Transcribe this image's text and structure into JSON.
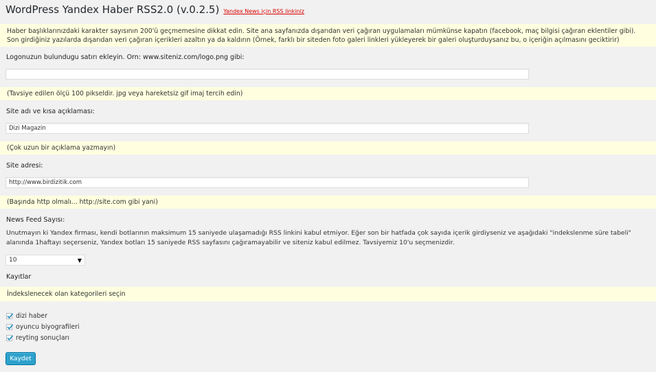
{
  "header": {
    "title": "WordPress Yandex Haber RSS2.0 (v.0.2.5)",
    "link": "Yandex News için RSS linkiniz"
  },
  "top_notice": "Haber başlıklarınızdaki karakter sayısının 200'ü geçmemesine dikkat edin. Site ana sayfanızda dışarıdan veri çağıran uygulamaları mümkünse kapatın (facebook, maç bilgisi çağıran eklentiler gibi). Son girdiğiniz yazılarda dışarıdan veri çağıran içerikleri azaltın ya da kaldırın (Örnek, farklı bir siteden foto galeri linkleri yükleyerek bir galeri oluşturduysanız bu, o içeriğin açılmasını geciktirir)",
  "logo": {
    "label": "Logonuzun bulundugu satırı ekleyin. Orn: www.siteniz.com/logo.png gibi:",
    "value": "",
    "hint": "(Tavsiye edilen ölçü 100 pikseldir. jpg veya hareketsiz gif imaj tercih edin)"
  },
  "site_name": {
    "label": "Site adı ve kısa açıklaması:",
    "value": "Dizi Magazin",
    "hint": "(Çok uzun bir açıklama yazmayın)"
  },
  "site_url": {
    "label": "Site adresi:",
    "value": "http://www.birdizitik.com",
    "hint": "(Başında http olmalı... http://site.com gibi yani)"
  },
  "feed_count": {
    "label": "News Feed Sayısı:",
    "description": "Unutmayın ki Yandex firması, kendi botlarının maksimum 15 saniyede ulaşamadığı RSS linkini kabul etmiyor. Eğer son bir hatfada çok sayıda içerik girdiyseniz ve aşağıdaki \"indekslenme süre tabeli\" alanında 1haftayı seçerseniz, Yandex botları 15 saniyede RSS sayfasını çağıramayabilir ve siteniz kabul edilmez. Tavsiyemiz 10'u seçmenizdir.",
    "selected": "10"
  },
  "records": {
    "label": "Kayıtlar",
    "notice": "İndekslenecek olan kategorileri seçin",
    "categories": [
      {
        "label": "dizi haber",
        "checked": true
      },
      {
        "label": "oyuncu biyografileri",
        "checked": true
      },
      {
        "label": "reyting sonuçları",
        "checked": true
      }
    ]
  },
  "save_button": "Kaydet",
  "colors": {
    "notice_bg": "#ffffe0",
    "button_bg": "#2ea2cc",
    "link": "#dd0000"
  }
}
